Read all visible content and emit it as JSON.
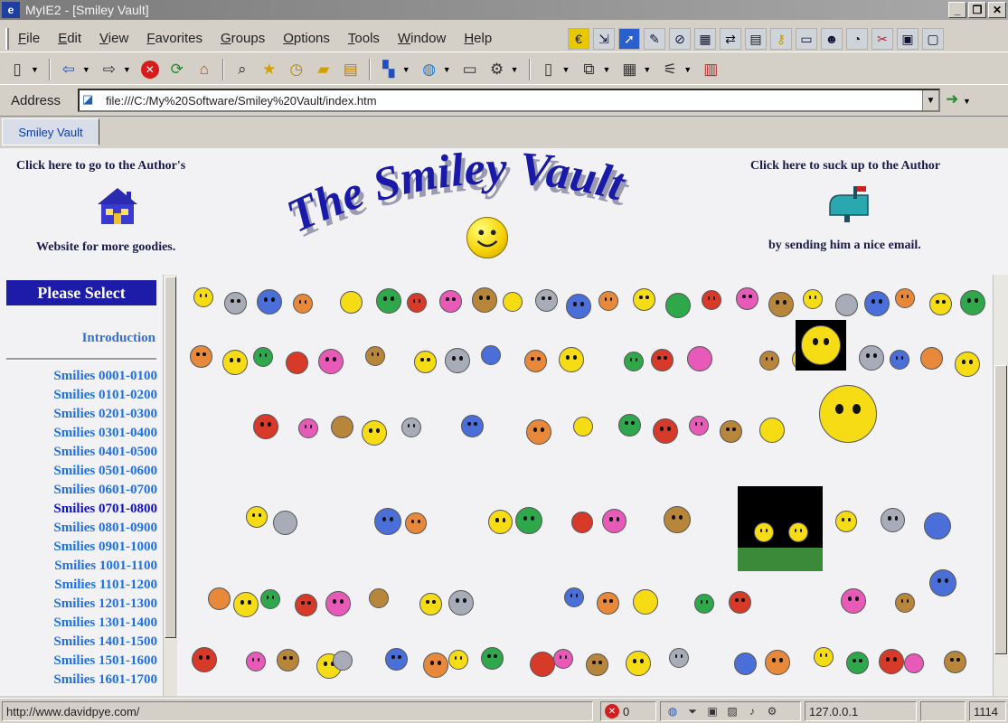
{
  "window": {
    "title": "MyIE2 - [Smiley Vault]",
    "buttons": {
      "minimize": "_",
      "restore": "❐",
      "close": "✕"
    }
  },
  "menu": [
    "File",
    "Edit",
    "View",
    "Favorites",
    "Groups",
    "Options",
    "Tools",
    "Window",
    "Help"
  ],
  "address": {
    "label": "Address",
    "url": "file:///C:/My%20Software/Smiley%20Vault/index.htm"
  },
  "tab": {
    "label": "Smiley Vault"
  },
  "page": {
    "author_link_top": "Click here to go to the Author's",
    "author_link_bottom": "Website for more goodies.",
    "email_link_top": "Click here to suck up to the Author",
    "email_link_bottom": "by sending him a nice email.",
    "logo_text": "The Smiley Vault",
    "please_select": "Please Select",
    "introduction": "Introduction",
    "ranges": [
      "Smilies 0001-0100",
      "Smilies 0101-0200",
      "Smilies 0201-0300",
      "Smilies 0301-0400",
      "Smilies 0401-0500",
      "Smilies 0501-0600",
      "Smilies 0601-0700",
      "Smilies 0701-0800",
      "Smilies 0801-0900",
      "Smilies 0901-1000",
      "Smilies 1001-1100",
      "Smilies 1101-1200",
      "Smilies 1201-1300",
      "Smilies 1301-1400",
      "Smilies 1401-1500",
      "Smilies 1501-1600",
      "Smilies 1601-1700"
    ],
    "visited_range": "Smilies 0701-0800"
  },
  "status": {
    "url": "http://www.davidpye.com/",
    "stop_count": "0",
    "ip": "127.0.0.1",
    "right_number": "1114"
  },
  "colors": {
    "smiley_yellow": "#f6dc14",
    "smiley_blue": "#4a6fd8",
    "smiley_gray": "#a8acb8",
    "smiley_red": "#d83a2a",
    "smiley_green": "#2ea84a",
    "smiley_orange": "#e8883a",
    "smiley_pink": "#e85ab8",
    "smiley_brown": "#b8863a"
  }
}
